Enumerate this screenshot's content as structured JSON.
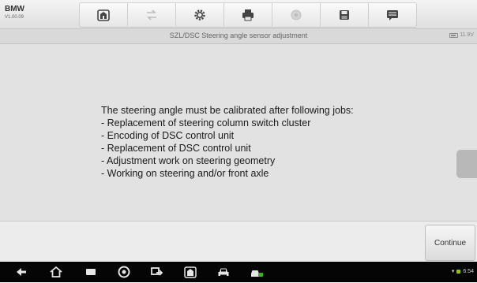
{
  "app": {
    "name": "BMW",
    "version": "V1.00.09"
  },
  "toolbar": {
    "buttons": [
      {
        "icon": "home-icon",
        "label": "Home"
      },
      {
        "icon": "vehicle-swap-icon",
        "label": "Vehicle swap"
      },
      {
        "icon": "gear-icon",
        "label": "Settings"
      },
      {
        "icon": "printer-icon",
        "label": "Print"
      },
      {
        "icon": "help-icon",
        "label": "Help"
      },
      {
        "icon": "save-icon",
        "label": "Save"
      },
      {
        "icon": "message-icon",
        "label": "Data logging"
      }
    ]
  },
  "titlebar": {
    "title": "SZL/DSC  Steering angle sensor adjustment",
    "voltage": "11.9V"
  },
  "content": {
    "lead": "The steering angle must be calibrated after following jobs:",
    "items": [
      "- Replacement of steering column switch cluster",
      "- Encoding of DSC control unit",
      "- Replacement of DSC control unit",
      "- Adjustment work on steering geometry",
      "- Working on steering and/or front axle"
    ]
  },
  "actions": {
    "continue_label": "Continue"
  },
  "system": {
    "clock": "6:54"
  },
  "colors": {
    "nav_bg": "#050505",
    "content_bg": "#e2e2e2",
    "battery_green": "#8fc31f"
  }
}
